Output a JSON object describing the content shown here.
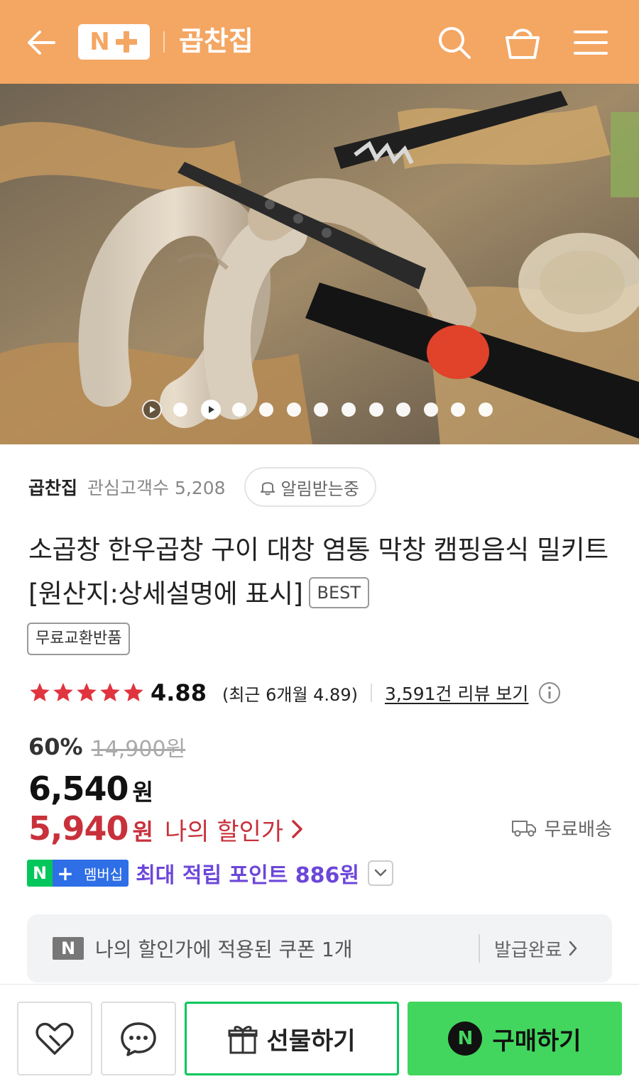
{
  "header": {
    "logo_n": "N",
    "store_name": "곱찬집",
    "bg_color": "#f4a663"
  },
  "hero": {
    "pager_count": 13,
    "active_index": 2,
    "video_slides": [
      0,
      2
    ]
  },
  "seller": {
    "name": "곱찬집",
    "fans_label": "관심고객수 5,208",
    "alarm_label": "알림받는중"
  },
  "product": {
    "title": "소곱창 한우곱창 구이 대창 염통 막창 캠핑음식 밀키트 [원산지:상세설명에 표시]",
    "best_badge": "BEST",
    "free_return_tag": "무료교환반품"
  },
  "rating": {
    "score": "4.88",
    "stars": 5,
    "recent": "(최근 6개월 4.89)",
    "review_link": "3,591건 리뷰 보기"
  },
  "price": {
    "discount_pct": "60%",
    "original": "14,900원",
    "sale_number": "6,540",
    "sale_unit": "원",
    "my_number": "5,940",
    "my_unit": "원",
    "my_label": "나의 할인가",
    "shipping": "무료배송"
  },
  "points": {
    "badge_n": "N",
    "badge_plus": "+",
    "badge_member": "멤버십",
    "text": "최대 적립 포인트 886원"
  },
  "coupon": {
    "n_label": "N",
    "text": "나의 할인가에 적용된 쿠폰 1개",
    "issued": "발급완료"
  },
  "bottom_bar": {
    "gift_label": "선물하기",
    "buy_n": "N",
    "buy_label": "구매하기"
  },
  "colors": {
    "accent_orange": "#f4a663",
    "price_red": "#c8313b",
    "naver_green": "#03c75a",
    "buy_green": "#43d65e",
    "point_purple": "#6c47d9",
    "star_red": "#e0343f"
  }
}
